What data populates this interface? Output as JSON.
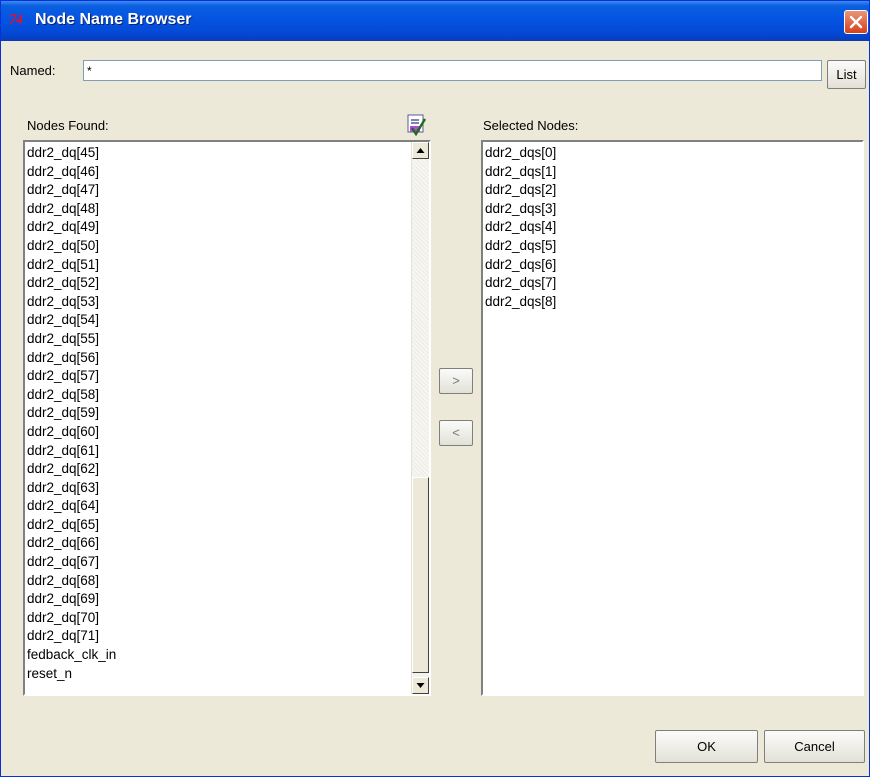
{
  "window": {
    "title": "Node Name Browser",
    "app_icon_text": "74"
  },
  "named": {
    "label": "Named:",
    "value": "*",
    "list_button": "List"
  },
  "nodes_found": {
    "label": "Nodes Found:",
    "items": [
      "ddr2_dq[45]",
      "ddr2_dq[46]",
      "ddr2_dq[47]",
      "ddr2_dq[48]",
      "ddr2_dq[49]",
      "ddr2_dq[50]",
      "ddr2_dq[51]",
      "ddr2_dq[52]",
      "ddr2_dq[53]",
      "ddr2_dq[54]",
      "ddr2_dq[55]",
      "ddr2_dq[56]",
      "ddr2_dq[57]",
      "ddr2_dq[58]",
      "ddr2_dq[59]",
      "ddr2_dq[60]",
      "ddr2_dq[61]",
      "ddr2_dq[62]",
      "ddr2_dq[63]",
      "ddr2_dq[64]",
      "ddr2_dq[65]",
      "ddr2_dq[66]",
      "ddr2_dq[67]",
      "ddr2_dq[68]",
      "ddr2_dq[69]",
      "ddr2_dq[70]",
      "ddr2_dq[71]",
      "fedback_clk_in",
      "reset_n"
    ]
  },
  "selected_nodes": {
    "label": "Selected Nodes:",
    "items": [
      "ddr2_dqs[0]",
      "ddr2_dqs[1]",
      "ddr2_dqs[2]",
      "ddr2_dqs[3]",
      "ddr2_dqs[4]",
      "ddr2_dqs[5]",
      "ddr2_dqs[6]",
      "ddr2_dqs[7]",
      "ddr2_dqs[8]"
    ]
  },
  "transfer": {
    "add": ">",
    "remove": "<"
  },
  "footer": {
    "ok": "OK",
    "cancel": "Cancel"
  },
  "colors": {
    "titlebar": "#0554e2",
    "dialog_bg": "#ece9d8",
    "close_button": "#d6401c"
  },
  "icons": {
    "close": "close-icon",
    "select_all": "select-all-icon"
  }
}
